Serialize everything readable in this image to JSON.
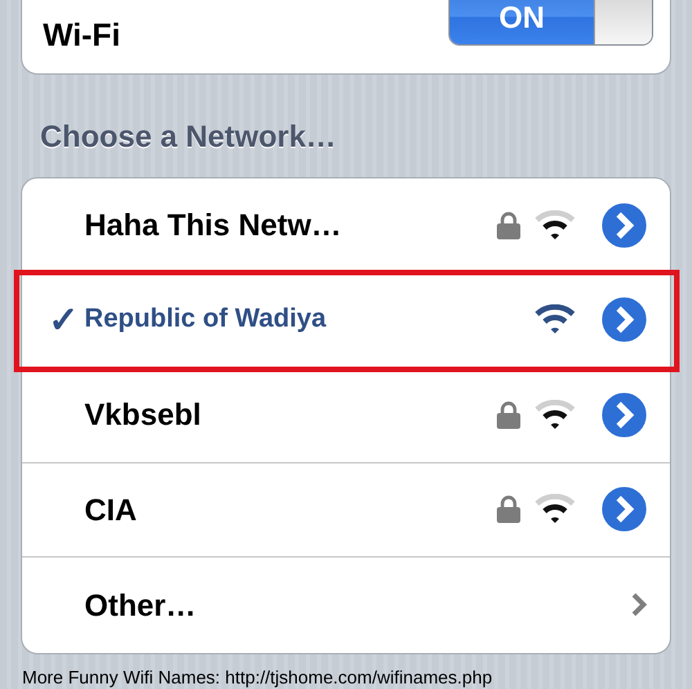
{
  "wifi": {
    "label": "Wi-Fi",
    "on": true,
    "toggle_text": "ON"
  },
  "section_title": "Choose a Network…",
  "networks": [
    {
      "kind": "network",
      "name": "Haha This Netw…",
      "selected": false,
      "secured": true,
      "highlighted": false
    },
    {
      "kind": "network",
      "name": "Republic of Wadiya",
      "check": "✓",
      "selected": true,
      "secured": false,
      "highlighted": true
    },
    {
      "kind": "network",
      "name": "Vkbsebl",
      "selected": false,
      "secured": true,
      "highlighted": false
    },
    {
      "kind": "network",
      "name": "CIA",
      "selected": false,
      "secured": true,
      "highlighted": false
    },
    {
      "kind": "other",
      "name": "Other…"
    }
  ],
  "caption": "More Funny Wifi Names: http://tjshome.com/wifinames.php"
}
